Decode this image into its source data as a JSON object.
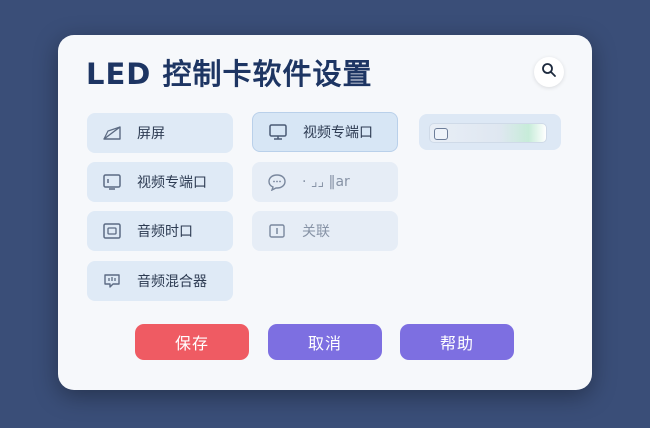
{
  "header": {
    "title": "LED  控制卡软件设置"
  },
  "search": {
    "icon": "search-icon"
  },
  "tiles": [
    {
      "label": "屏屏",
      "icon": "screen-angle-icon"
    },
    {
      "label": "视频专端口",
      "icon": "monitor-icon"
    },
    {
      "label": "视频专端口",
      "icon": "display-port-icon"
    },
    {
      "label": "· ⌟⌟ ‖ar",
      "icon": "chat-icon"
    },
    {
      "label": "音频时口",
      "icon": "audio-port-icon"
    },
    {
      "label": "关联",
      "icon": "link-icon"
    },
    {
      "label": "音频混合器",
      "icon": "audio-mixer-icon"
    }
  ],
  "actions": {
    "save": "保存",
    "cancel": "取消",
    "help": "帮助"
  },
  "colors": {
    "save": "#ef5b63",
    "cancel": "#7d6fe1",
    "help": "#7d6fe1",
    "title": "#1d3563"
  }
}
